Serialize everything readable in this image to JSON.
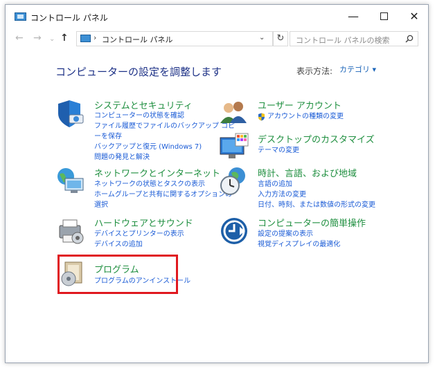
{
  "window": {
    "title": "コントロール パネル",
    "controls": {
      "minimize": "—",
      "close": "✕"
    }
  },
  "nav": {
    "back": "←",
    "forward": "→",
    "recent": "⌄",
    "up": "↑",
    "address_sep": "›",
    "address": "コントロール パネル",
    "address_dropdown": "⌄",
    "refresh": "↻",
    "search_placeholder": "コントロール パネルの検索"
  },
  "content": {
    "heading": "コンピューターの設定を調整します",
    "view_by_label": "表示方法:",
    "view_by_value": "カテゴリ ▾"
  },
  "categories": [
    {
      "title": "システムとセキュリティ",
      "links": [
        "コンピューターの状態を確認",
        "ファイル履歴でファイルのバックアップ コピ",
        "ーを保存",
        "バックアップと復元 (Windows 7)",
        "問題の発見と解決"
      ]
    },
    {
      "title": "ネットワークとインターネット",
      "links": [
        "ネットワークの状態とタスクの表示",
        "ホームグループと共有に関するオプションの",
        "選択"
      ]
    },
    {
      "title": "ハードウェアとサウンド",
      "links": [
        "デバイスとプリンターの表示",
        "デバイスの追加"
      ]
    },
    {
      "title": "プログラム",
      "links": [
        "プログラムのアンインストール"
      ]
    },
    {
      "title": "ユーザー アカウント",
      "links": [
        "アカウントの種類の変更"
      ]
    },
    {
      "title": "デスクトップのカスタマイズ",
      "links": [
        "テーマの変更"
      ]
    },
    {
      "title": "時計、言語、および地域",
      "links": [
        "言語の追加",
        "入力方法の変更",
        "日付、時刻、または数値の形式の変更"
      ]
    },
    {
      "title": "コンピューターの簡単操作",
      "links": [
        "設定の提案の表示",
        "視覚ディスプレイの最適化"
      ]
    }
  ],
  "colors": {
    "category_title": "#1d8e3e",
    "link": "#1a5bd6",
    "heading": "#1e3287",
    "highlight_border": "#e0181f"
  }
}
